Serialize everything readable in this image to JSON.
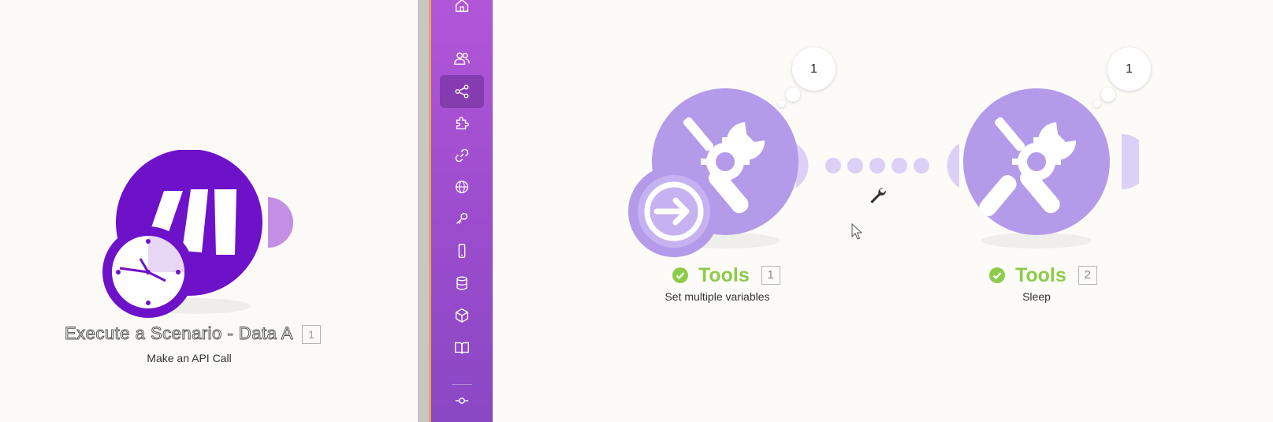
{
  "left_module": {
    "title": "Execute a Scenario - Data A",
    "number": "1",
    "subtitle": "Make an API Call"
  },
  "sidebar": {
    "items": [
      {
        "icon": "home-icon"
      },
      {
        "icon": "team-icon"
      },
      {
        "icon": "share-icon",
        "active": true
      },
      {
        "icon": "puzzle-icon"
      },
      {
        "icon": "link-icon"
      },
      {
        "icon": "globe-icon"
      },
      {
        "icon": "key-icon"
      },
      {
        "icon": "mobile-icon"
      },
      {
        "icon": "database-icon"
      },
      {
        "icon": "cube-icon"
      },
      {
        "icon": "book-icon"
      },
      {
        "icon": "commit-icon"
      }
    ]
  },
  "modules": [
    {
      "app": "Tools",
      "number": "1",
      "subtitle": "Set multiple variables",
      "bubble_count": "1",
      "status": "success"
    },
    {
      "app": "Tools",
      "number": "2",
      "subtitle": "Sleep",
      "bubble_count": "1",
      "status": "success"
    }
  ],
  "colors": {
    "tools_purple": "#b49bea",
    "tools_purple_light": "#d9ccf5",
    "make_purple": "#6e12c9",
    "success_green": "#8dcb4a",
    "sidebar_purple": "#a04fd2"
  }
}
